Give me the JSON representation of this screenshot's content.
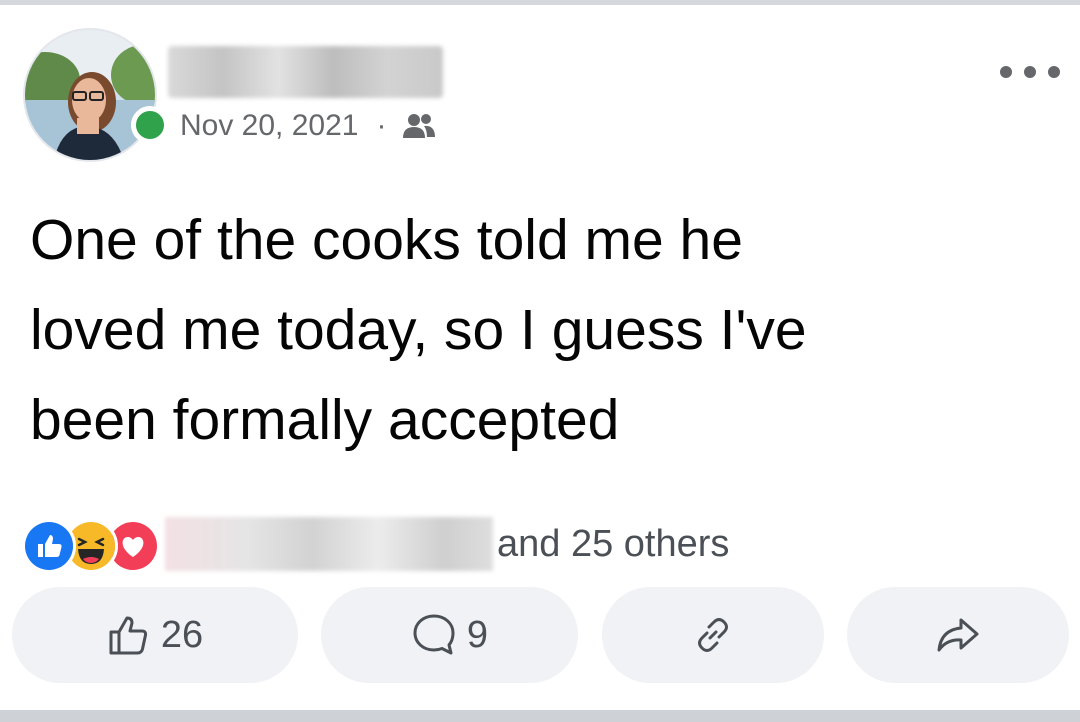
{
  "post": {
    "date": "Nov 20, 2021",
    "separator": "·",
    "audience_icon": "friends-icon",
    "text": "One of the cooks told me he\nloved me today, so I guess I've\nbeen formally accepted"
  },
  "reactions": {
    "types": [
      "like",
      "haha",
      "love"
    ],
    "others_text": "and 25 others"
  },
  "actions": {
    "like_count": "26",
    "comment_count": "9"
  },
  "colors": {
    "online": "#31a24c",
    "like_blue": "#1877f2",
    "love_red": "#f33e58",
    "haha_yellow": "#f7b928",
    "secondary_text": "#65676b",
    "button_bg": "#f0f2f5"
  }
}
